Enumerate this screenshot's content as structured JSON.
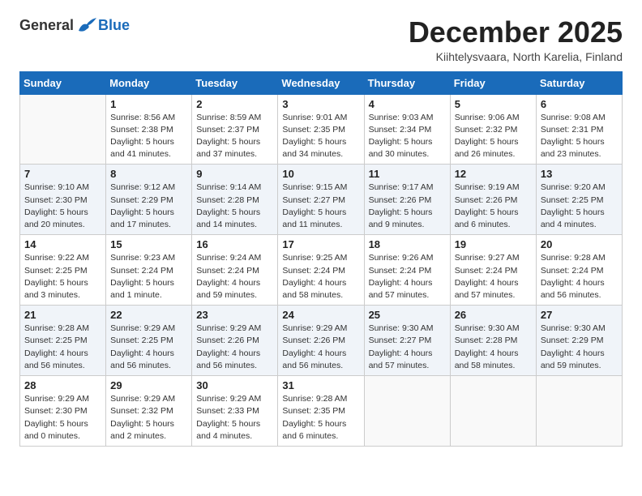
{
  "header": {
    "logo_general": "General",
    "logo_blue": "Blue",
    "month_title": "December 2025",
    "location": "Kiihtelysvaara, North Karelia, Finland"
  },
  "weekdays": [
    "Sunday",
    "Monday",
    "Tuesday",
    "Wednesday",
    "Thursday",
    "Friday",
    "Saturday"
  ],
  "weeks": [
    [
      {
        "day": "",
        "sunrise": "",
        "sunset": "",
        "daylight": ""
      },
      {
        "day": "1",
        "sunrise": "Sunrise: 8:56 AM",
        "sunset": "Sunset: 2:38 PM",
        "daylight": "Daylight: 5 hours and 41 minutes."
      },
      {
        "day": "2",
        "sunrise": "Sunrise: 8:59 AM",
        "sunset": "Sunset: 2:37 PM",
        "daylight": "Daylight: 5 hours and 37 minutes."
      },
      {
        "day": "3",
        "sunrise": "Sunrise: 9:01 AM",
        "sunset": "Sunset: 2:35 PM",
        "daylight": "Daylight: 5 hours and 34 minutes."
      },
      {
        "day": "4",
        "sunrise": "Sunrise: 9:03 AM",
        "sunset": "Sunset: 2:34 PM",
        "daylight": "Daylight: 5 hours and 30 minutes."
      },
      {
        "day": "5",
        "sunrise": "Sunrise: 9:06 AM",
        "sunset": "Sunset: 2:32 PM",
        "daylight": "Daylight: 5 hours and 26 minutes."
      },
      {
        "day": "6",
        "sunrise": "Sunrise: 9:08 AM",
        "sunset": "Sunset: 2:31 PM",
        "daylight": "Daylight: 5 hours and 23 minutes."
      }
    ],
    [
      {
        "day": "7",
        "sunrise": "Sunrise: 9:10 AM",
        "sunset": "Sunset: 2:30 PM",
        "daylight": "Daylight: 5 hours and 20 minutes."
      },
      {
        "day": "8",
        "sunrise": "Sunrise: 9:12 AM",
        "sunset": "Sunset: 2:29 PM",
        "daylight": "Daylight: 5 hours and 17 minutes."
      },
      {
        "day": "9",
        "sunrise": "Sunrise: 9:14 AM",
        "sunset": "Sunset: 2:28 PM",
        "daylight": "Daylight: 5 hours and 14 minutes."
      },
      {
        "day": "10",
        "sunrise": "Sunrise: 9:15 AM",
        "sunset": "Sunset: 2:27 PM",
        "daylight": "Daylight: 5 hours and 11 minutes."
      },
      {
        "day": "11",
        "sunrise": "Sunrise: 9:17 AM",
        "sunset": "Sunset: 2:26 PM",
        "daylight": "Daylight: 5 hours and 9 minutes."
      },
      {
        "day": "12",
        "sunrise": "Sunrise: 9:19 AM",
        "sunset": "Sunset: 2:26 PM",
        "daylight": "Daylight: 5 hours and 6 minutes."
      },
      {
        "day": "13",
        "sunrise": "Sunrise: 9:20 AM",
        "sunset": "Sunset: 2:25 PM",
        "daylight": "Daylight: 5 hours and 4 minutes."
      }
    ],
    [
      {
        "day": "14",
        "sunrise": "Sunrise: 9:22 AM",
        "sunset": "Sunset: 2:25 PM",
        "daylight": "Daylight: 5 hours and 3 minutes."
      },
      {
        "day": "15",
        "sunrise": "Sunrise: 9:23 AM",
        "sunset": "Sunset: 2:24 PM",
        "daylight": "Daylight: 5 hours and 1 minute."
      },
      {
        "day": "16",
        "sunrise": "Sunrise: 9:24 AM",
        "sunset": "Sunset: 2:24 PM",
        "daylight": "Daylight: 4 hours and 59 minutes."
      },
      {
        "day": "17",
        "sunrise": "Sunrise: 9:25 AM",
        "sunset": "Sunset: 2:24 PM",
        "daylight": "Daylight: 4 hours and 58 minutes."
      },
      {
        "day": "18",
        "sunrise": "Sunrise: 9:26 AM",
        "sunset": "Sunset: 2:24 PM",
        "daylight": "Daylight: 4 hours and 57 minutes."
      },
      {
        "day": "19",
        "sunrise": "Sunrise: 9:27 AM",
        "sunset": "Sunset: 2:24 PM",
        "daylight": "Daylight: 4 hours and 57 minutes."
      },
      {
        "day": "20",
        "sunrise": "Sunrise: 9:28 AM",
        "sunset": "Sunset: 2:24 PM",
        "daylight": "Daylight: 4 hours and 56 minutes."
      }
    ],
    [
      {
        "day": "21",
        "sunrise": "Sunrise: 9:28 AM",
        "sunset": "Sunset: 2:25 PM",
        "daylight": "Daylight: 4 hours and 56 minutes."
      },
      {
        "day": "22",
        "sunrise": "Sunrise: 9:29 AM",
        "sunset": "Sunset: 2:25 PM",
        "daylight": "Daylight: 4 hours and 56 minutes."
      },
      {
        "day": "23",
        "sunrise": "Sunrise: 9:29 AM",
        "sunset": "Sunset: 2:26 PM",
        "daylight": "Daylight: 4 hours and 56 minutes."
      },
      {
        "day": "24",
        "sunrise": "Sunrise: 9:29 AM",
        "sunset": "Sunset: 2:26 PM",
        "daylight": "Daylight: 4 hours and 56 minutes."
      },
      {
        "day": "25",
        "sunrise": "Sunrise: 9:30 AM",
        "sunset": "Sunset: 2:27 PM",
        "daylight": "Daylight: 4 hours and 57 minutes."
      },
      {
        "day": "26",
        "sunrise": "Sunrise: 9:30 AM",
        "sunset": "Sunset: 2:28 PM",
        "daylight": "Daylight: 4 hours and 58 minutes."
      },
      {
        "day": "27",
        "sunrise": "Sunrise: 9:30 AM",
        "sunset": "Sunset: 2:29 PM",
        "daylight": "Daylight: 4 hours and 59 minutes."
      }
    ],
    [
      {
        "day": "28",
        "sunrise": "Sunrise: 9:29 AM",
        "sunset": "Sunset: 2:30 PM",
        "daylight": "Daylight: 5 hours and 0 minutes."
      },
      {
        "day": "29",
        "sunrise": "Sunrise: 9:29 AM",
        "sunset": "Sunset: 2:32 PM",
        "daylight": "Daylight: 5 hours and 2 minutes."
      },
      {
        "day": "30",
        "sunrise": "Sunrise: 9:29 AM",
        "sunset": "Sunset: 2:33 PM",
        "daylight": "Daylight: 5 hours and 4 minutes."
      },
      {
        "day": "31",
        "sunrise": "Sunrise: 9:28 AM",
        "sunset": "Sunset: 2:35 PM",
        "daylight": "Daylight: 5 hours and 6 minutes."
      },
      {
        "day": "",
        "sunrise": "",
        "sunset": "",
        "daylight": ""
      },
      {
        "day": "",
        "sunrise": "",
        "sunset": "",
        "daylight": ""
      },
      {
        "day": "",
        "sunrise": "",
        "sunset": "",
        "daylight": ""
      }
    ]
  ]
}
